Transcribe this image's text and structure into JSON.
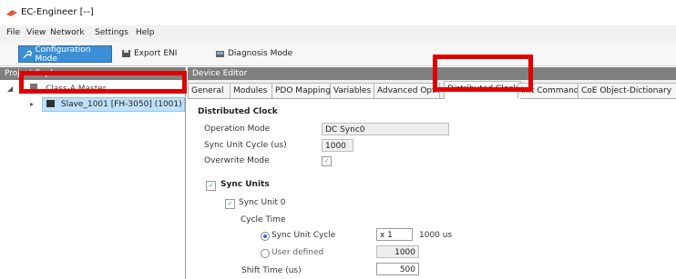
{
  "window": {
    "title": "EC-Engineer [--]"
  },
  "menu": [
    "File",
    "View",
    "Network",
    "Settings",
    "Help"
  ],
  "toolbar": {
    "config_mode": "Configuration Mode",
    "export_eni": "Export ENI",
    "diagnosis_mode": "Diagnosis Mode"
  },
  "explorer": {
    "header": "Project Explorer",
    "root": "Class-A Master",
    "selected": "Slave_1001 [FH-3050] (1001)"
  },
  "editor": {
    "header": "Device Editor",
    "tabs": [
      "General",
      "Modules",
      "PDO Mapping",
      "Variables",
      "Advanced Options",
      "Distributed Clock",
      "Init Commands",
      "CoE Object-Dictionary"
    ],
    "active_tab": "Distributed Clock"
  },
  "dc": {
    "section": "Distributed Clock",
    "operation_mode_label": "Operation Mode",
    "operation_mode_value": "DC Sync0",
    "sync_cycle_label": "Sync Unit Cycle (us)",
    "sync_cycle_value": "1000",
    "overwrite_label": "Overwrite Mode",
    "overwrite_checked": "✓",
    "sync_units_label": "Sync Units",
    "sync_unit0_label": "Sync Unit 0",
    "cycle_time_label": "Cycle Time",
    "radio_sync_cycle": "Sync Unit Cycle",
    "multiplier_value": "x 1",
    "multiplier_unit": "1000 us",
    "radio_user_defined": "User defined",
    "user_defined_value": "1000",
    "shift_time_label": "Shift Time (us)",
    "shift_time_value": "500"
  },
  "colors": {
    "highlight": "#e00000",
    "accent": "#3c8fd6"
  }
}
